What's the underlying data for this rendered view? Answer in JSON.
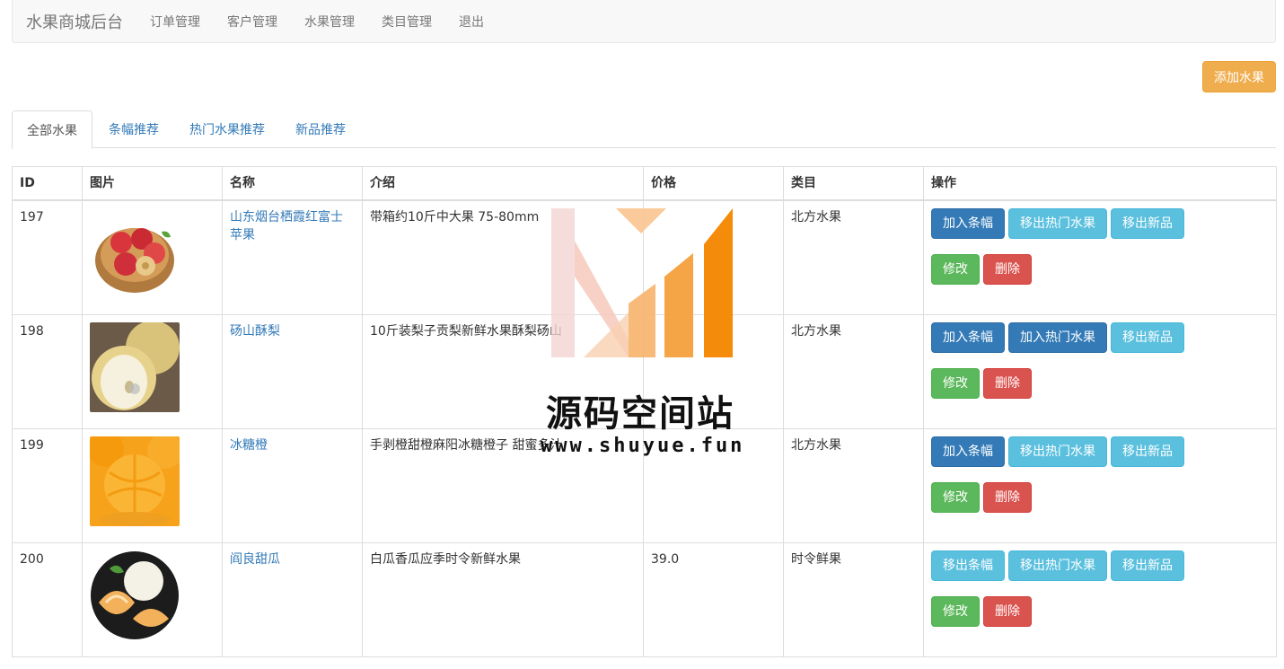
{
  "navbar": {
    "brand": "水果商城后台",
    "items": [
      "订单管理",
      "客户管理",
      "水果管理",
      "类目管理",
      "退出"
    ]
  },
  "toolbar": {
    "add_label": "添加水果"
  },
  "tabs": [
    {
      "label": "全部水果",
      "active": true
    },
    {
      "label": "条幅推荐",
      "active": false
    },
    {
      "label": "热门水果推荐",
      "active": false
    },
    {
      "label": "新品推荐",
      "active": false
    }
  ],
  "table": {
    "headers": [
      "ID",
      "图片",
      "名称",
      "介绍",
      "价格",
      "类目",
      "操作"
    ],
    "rows": [
      {
        "id": "197",
        "image": "apple-basket-image",
        "name": "山东烟台栖霞红富士苹果",
        "intro": "带箱约10斤中大果 75-80mm",
        "price": "",
        "category": "北方水果",
        "ops": [
          {
            "label": "加入条幅",
            "style": "primary"
          },
          {
            "label": "移出热门水果",
            "style": "info"
          },
          {
            "label": "移出新品",
            "style": "info"
          }
        ]
      },
      {
        "id": "198",
        "image": "pear-image",
        "name": "砀山酥梨",
        "intro": "10斤装梨子贡梨新鲜水果酥梨砀山",
        "price": "",
        "category": "北方水果",
        "ops": [
          {
            "label": "加入条幅",
            "style": "primary"
          },
          {
            "label": "加入热门水果",
            "style": "primary"
          },
          {
            "label": "移出新品",
            "style": "info"
          }
        ]
      },
      {
        "id": "199",
        "image": "orange-image",
        "name": "冰糖橙",
        "intro": "手剥橙甜橙麻阳冰糖橙子 甜蜜多汁",
        "price": "",
        "category": "北方水果",
        "ops": [
          {
            "label": "加入条幅",
            "style": "primary"
          },
          {
            "label": "移出热门水果",
            "style": "info"
          },
          {
            "label": "移出新品",
            "style": "info"
          }
        ]
      },
      {
        "id": "200",
        "image": "melon-image",
        "name": "阎良甜瓜",
        "intro": "白瓜香瓜应季时令新鲜水果",
        "price": "39.0",
        "category": "时令鲜果",
        "ops": [
          {
            "label": "移出条幅",
            "style": "info"
          },
          {
            "label": "移出热门水果",
            "style": "info"
          },
          {
            "label": "移出新品",
            "style": "info"
          }
        ]
      }
    ],
    "row_actions": {
      "edit_label": "修改",
      "delete_label": "删除"
    }
  },
  "watermark": {
    "title": "源码空间站",
    "url": "www.shuyue.fun"
  },
  "colors": {
    "primary": "#337ab7",
    "info": "#5bc0de",
    "success": "#5cb85c",
    "danger": "#d9534f",
    "warning": "#f0ad4e"
  }
}
